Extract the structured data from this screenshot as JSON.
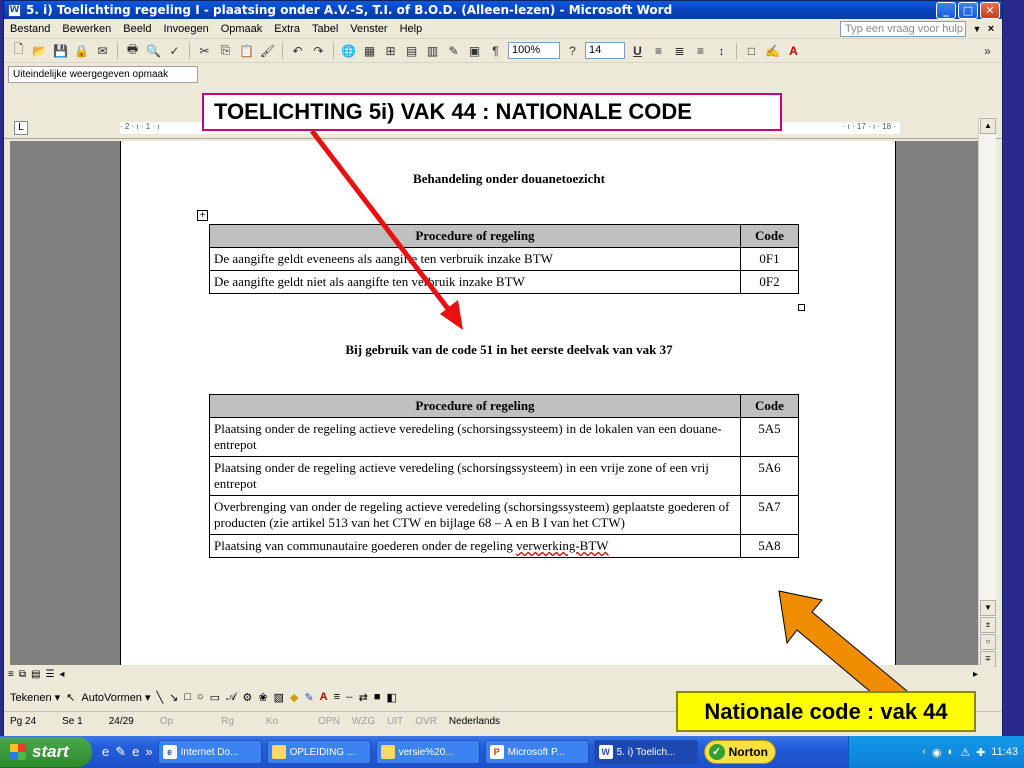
{
  "window": {
    "title": "5. i) Toelichting regeling I - plaatsing onder A.V.-S, T.I. of B.O.D.      (Alleen-lezen) - Microsoft Word",
    "app_icon": "W",
    "minimize": "_",
    "maximize": "□",
    "close": "✕"
  },
  "menu": {
    "items": [
      "Bestand",
      "Bewerken",
      "Beeld",
      "Invoegen",
      "Opmaak",
      "Extra",
      "Tabel",
      "Venster",
      "Help"
    ],
    "help_placeholder": "Typ een vraag voor hulp",
    "close_doc": "×"
  },
  "toolbar": {
    "zoom": "100%",
    "font_size": "14",
    "paragraph_mark": "¶",
    "overflow": "»"
  },
  "view_mode": "Uiteindelijke weergegeven opmaak",
  "ruler": {
    "left_scale": "· 2 · ı · 1 · ı",
    "right_scale": "· ı · 17 · ı · 18 ·"
  },
  "document": {
    "heading1": "Behandeling onder douanetoezicht",
    "table1": {
      "headers": [
        "Procedure of regeling",
        "Code"
      ],
      "rows": [
        [
          "De aangifte geldt eveneens als aangifte ten verbruik inzake BTW",
          "0F1"
        ],
        [
          "De aangifte geldt niet als aangifte ten verbruik inzake BTW",
          "0F2"
        ]
      ]
    },
    "heading2": "Bij gebruik van de code 51 in het eerste deelvak van vak 37",
    "table2": {
      "headers": [
        "Procedure of regeling",
        "Code"
      ],
      "rows": [
        [
          "Plaatsing onder de regeling actieve veredeling (schorsingssysteem) in de lokalen van een douane-entrepot",
          "5A5"
        ],
        [
          "Plaatsing onder de regeling actieve veredeling (schorsingssysteem) in een vrije zone of een vrij entrepot",
          "5A6"
        ],
        [
          "Overbrenging van onder de regeling actieve veredeling (schorsingssysteem) geplaatste goederen of producten (zie artikel 513 van het CTW en bijlage 68 – A en B I van het CTW)",
          "5A7"
        ],
        [
          "Plaatsing van communautaire goederen onder de regeling ",
          "5A8"
        ]
      ],
      "last_row_underlined": "verwerking-BTW"
    }
  },
  "callouts": {
    "top": "TOELICHTING 5i) VAK 44 : NATIONALE CODE",
    "bottom": "Nationale code : vak 44"
  },
  "drawing_toolbar": {
    "draw": "Tekenen ▾",
    "autoshapes": "AutoVormen ▾"
  },
  "status": {
    "page": "Pg 24",
    "section": "Se 1",
    "pages": "24/29",
    "at": "Op",
    "line": "Rg",
    "col": "Ko",
    "rec": "OPN",
    "trk": "WZG",
    "ext": "UIT",
    "ovr": "OVR",
    "language": "Nederlands"
  },
  "taskbar": {
    "start": "start",
    "tasks": [
      "Internet Do...",
      "OPLEIDING ...",
      "versie%20...",
      "Microsoft P...",
      "5. i) Toelich..."
    ],
    "norton": "Norton",
    "clock": "11:43"
  },
  "colors": {
    "arrow_red": "#e81010",
    "arrow_orange": "#f08c00",
    "callout_bottom_bg": "#ffff00",
    "table_header_bg": "#c0c0c0"
  }
}
